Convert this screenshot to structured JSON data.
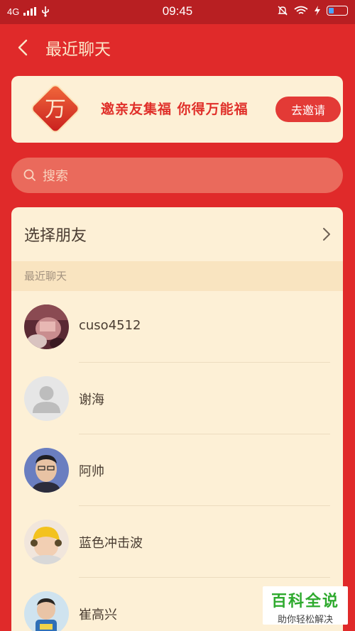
{
  "status_bar": {
    "network": "4G",
    "time": "09:45",
    "battery_level": 0.3
  },
  "header": {
    "title": "最近聊天"
  },
  "banner": {
    "badge_char": "万",
    "text": "邀亲友集福 你得万能福",
    "button_label": "去邀请"
  },
  "search": {
    "placeholder": "搜索"
  },
  "select_friend": {
    "label": "选择朋友"
  },
  "recent": {
    "section_label": "最近聊天",
    "contacts": [
      {
        "name": "cuso4512"
      },
      {
        "name": "谢海"
      },
      {
        "name": "阿帅"
      },
      {
        "name": "蓝色冲击波"
      },
      {
        "name": "崔高兴"
      }
    ]
  },
  "watermark": {
    "title": "百科全说",
    "subtitle": "助你轻松解决"
  },
  "colors": {
    "brand_red": "#e02a2a",
    "status_bar": "#b81f22",
    "cream": "#fdf0d6",
    "accent_button": "#e33a36"
  }
}
